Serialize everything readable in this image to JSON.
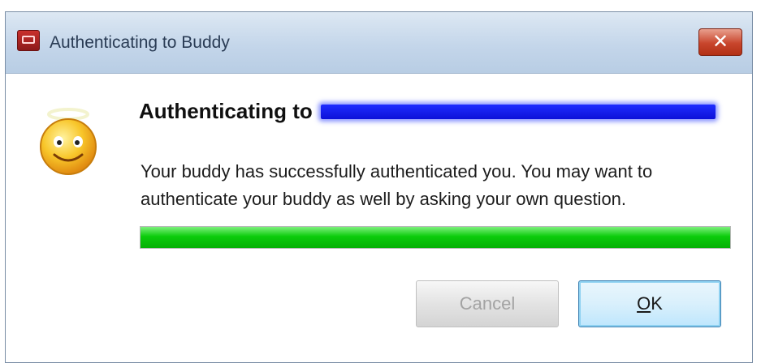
{
  "window": {
    "title": "Authenticating to Buddy"
  },
  "dialog": {
    "heading": "Authenticating to",
    "message": "Your buddy has successfully authenticated you.  You may want to authenticate your buddy as well by asking your own question.",
    "progress_fraction": 1.0,
    "progress_color": "#0ccc0c"
  },
  "buttons": {
    "cancel_label": "Cancel",
    "ok_mnemonic": "O",
    "ok_rest": "K"
  },
  "icons": {
    "app": "pidgin-otr-icon",
    "avatar": "angel-emoticon-icon",
    "close": "close-icon"
  }
}
